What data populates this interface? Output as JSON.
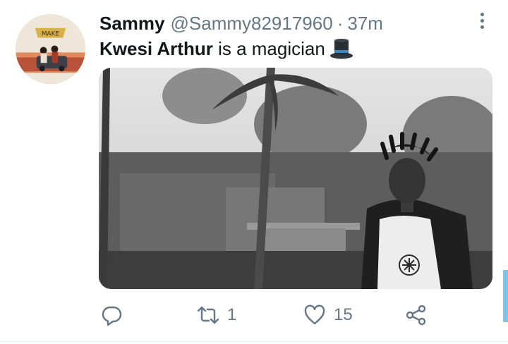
{
  "tweet": {
    "display_name": "Sammy",
    "handle": "@Sammy82917960",
    "separator": "·",
    "timestamp": "37m",
    "text_mention": "Kwesi Arthur",
    "text_rest": " is a magician",
    "emoji_icon": "top-hat-icon"
  },
  "actions": {
    "reply_icon": "reply-icon",
    "retweet_icon": "retweet-icon",
    "retweet_count": "1",
    "like_icon": "heart-icon",
    "like_count": "15",
    "share_icon": "share-icon"
  },
  "colors": {
    "text": "#14171a",
    "secondary": "#657786",
    "scroll_accent": "#7cc4ec"
  }
}
